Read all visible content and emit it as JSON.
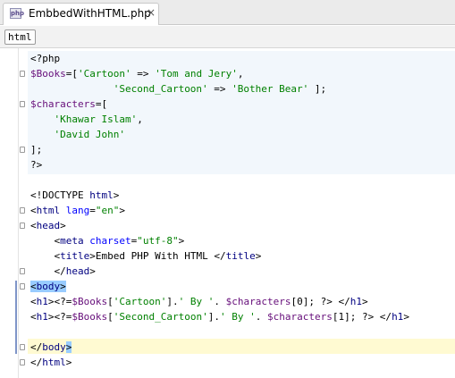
{
  "tab": {
    "icon": "php-file-icon",
    "icon_text": "php",
    "label": "EmbbedWithHTML.php",
    "close": "×"
  },
  "breadcrumb": {
    "label": "html"
  },
  "colors": {
    "plain": "#000000",
    "variable": "#660e7a",
    "string": "#008000",
    "tag": "#000080",
    "attribute": "#0000ff",
    "php_block_bg": "#f2f7fc",
    "current_line_bg": "#fffad2",
    "match_highlight": "#99ccff"
  },
  "code": {
    "lines": [
      {
        "tokens": [
          {
            "t": "<?php",
            "c": "plain"
          }
        ]
      },
      {
        "tokens": [
          {
            "t": "$Books",
            "c": "var"
          },
          {
            "t": "=[",
            "c": "plain"
          },
          {
            "t": "'Cartoon'",
            "c": "str"
          },
          {
            "t": " => ",
            "c": "plain"
          },
          {
            "t": "'Tom and Jery'",
            "c": "str"
          },
          {
            "t": ",",
            "c": "plain"
          }
        ]
      },
      {
        "tokens": [
          {
            "t": "              ",
            "c": "plain"
          },
          {
            "t": "'Second_Cartoon'",
            "c": "str"
          },
          {
            "t": " => ",
            "c": "plain"
          },
          {
            "t": "'Bother Bear'",
            "c": "str"
          },
          {
            "t": " ];",
            "c": "plain"
          }
        ]
      },
      {
        "tokens": [
          {
            "t": "$characters",
            "c": "var"
          },
          {
            "t": "=[",
            "c": "plain"
          }
        ]
      },
      {
        "tokens": [
          {
            "t": "    ",
            "c": "plain"
          },
          {
            "t": "'Khawar Islam'",
            "c": "str"
          },
          {
            "t": ",",
            "c": "plain"
          }
        ]
      },
      {
        "tokens": [
          {
            "t": "    ",
            "c": "plain"
          },
          {
            "t": "'David John'",
            "c": "str"
          }
        ]
      },
      {
        "tokens": [
          {
            "t": "];",
            "c": "plain"
          }
        ]
      },
      {
        "tokens": [
          {
            "t": "?>",
            "c": "plain"
          }
        ]
      },
      {
        "tokens": []
      },
      {
        "tokens": [
          {
            "t": "<!DOCTYPE ",
            "c": "plain"
          },
          {
            "t": "html",
            "c": "tag"
          },
          {
            "t": ">",
            "c": "plain"
          }
        ]
      },
      {
        "tokens": [
          {
            "t": "<",
            "c": "plain"
          },
          {
            "t": "html ",
            "c": "tag"
          },
          {
            "t": "lang",
            "c": "attr"
          },
          {
            "t": "=",
            "c": "plain"
          },
          {
            "t": "\"en\"",
            "c": "val"
          },
          {
            "t": ">",
            "c": "plain"
          }
        ]
      },
      {
        "tokens": [
          {
            "t": "<",
            "c": "plain"
          },
          {
            "t": "head",
            "c": "tag"
          },
          {
            "t": ">",
            "c": "plain"
          }
        ]
      },
      {
        "tokens": [
          {
            "t": "    <",
            "c": "plain"
          },
          {
            "t": "meta ",
            "c": "tag"
          },
          {
            "t": "charset",
            "c": "attr"
          },
          {
            "t": "=",
            "c": "plain"
          },
          {
            "t": "\"utf-8\"",
            "c": "val"
          },
          {
            "t": ">",
            "c": "plain"
          }
        ]
      },
      {
        "tokens": [
          {
            "t": "    <",
            "c": "plain"
          },
          {
            "t": "title",
            "c": "tag"
          },
          {
            "t": ">Embed PHP With HTML </",
            "c": "plain"
          },
          {
            "t": "title",
            "c": "tag"
          },
          {
            "t": ">",
            "c": "plain"
          }
        ]
      },
      {
        "tokens": [
          {
            "t": "    </",
            "c": "plain"
          },
          {
            "t": "head",
            "c": "tag"
          },
          {
            "t": ">",
            "c": "plain"
          }
        ]
      },
      {
        "tokens": [
          {
            "t": "<",
            "c": "plain",
            "hl": true
          },
          {
            "t": "body",
            "c": "tag",
            "hl": true
          },
          {
            "t": ">",
            "c": "plain",
            "hl": true
          }
        ]
      },
      {
        "tokens": [
          {
            "t": "<",
            "c": "plain"
          },
          {
            "t": "h1",
            "c": "tag"
          },
          {
            "t": "><?=",
            "c": "plain"
          },
          {
            "t": "$Books",
            "c": "var"
          },
          {
            "t": "[",
            "c": "plain"
          },
          {
            "t": "'Cartoon'",
            "c": "str"
          },
          {
            "t": "].",
            "c": "plain"
          },
          {
            "t": "' By '",
            "c": "str"
          },
          {
            "t": ". ",
            "c": "plain"
          },
          {
            "t": "$characters",
            "c": "var"
          },
          {
            "t": "[0]; ?> </",
            "c": "plain"
          },
          {
            "t": "h1",
            "c": "tag"
          },
          {
            "t": ">",
            "c": "plain"
          }
        ]
      },
      {
        "tokens": [
          {
            "t": "<",
            "c": "plain"
          },
          {
            "t": "h1",
            "c": "tag"
          },
          {
            "t": "><?=",
            "c": "plain"
          },
          {
            "t": "$Books",
            "c": "var"
          },
          {
            "t": "[",
            "c": "plain"
          },
          {
            "t": "'Second_Cartoon'",
            "c": "str"
          },
          {
            "t": "].",
            "c": "plain"
          },
          {
            "t": "' By '",
            "c": "str"
          },
          {
            "t": ". ",
            "c": "plain"
          },
          {
            "t": "$characters",
            "c": "var"
          },
          {
            "t": "[1]; ?> </",
            "c": "plain"
          },
          {
            "t": "h1",
            "c": "tag"
          },
          {
            "t": ">",
            "c": "plain"
          }
        ]
      },
      {
        "tokens": []
      },
      {
        "tokens": [
          {
            "t": "</",
            "c": "plain"
          },
          {
            "t": "body",
            "c": "tag"
          },
          {
            "t": ">",
            "c": "plain",
            "hl": true
          }
        ]
      },
      {
        "tokens": [
          {
            "t": "</",
            "c": "plain"
          },
          {
            "t": "html",
            "c": "tag"
          },
          {
            "t": ">",
            "c": "plain"
          }
        ]
      }
    ]
  }
}
